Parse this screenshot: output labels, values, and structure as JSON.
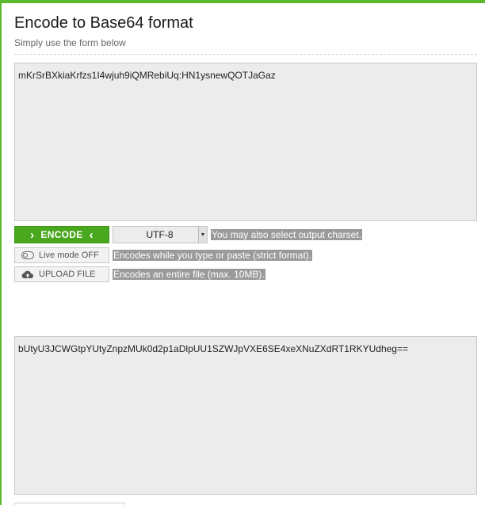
{
  "page": {
    "title": "Encode to Base64 format",
    "subtitle": "Simply use the form below"
  },
  "input": {
    "value": "mKrSrBXkiaKrfzs1I4wjuh9iQMRebiUq:HN1ysnewQOTJaGaz"
  },
  "controls": {
    "encode_label": "ENCODE",
    "charset_value": "UTF-8",
    "charset_hint": "You may also select output charset.",
    "live_mode_label": "Live mode OFF",
    "live_mode_hint": "Encodes while you type or paste (strict format).",
    "upload_label": "UPLOAD FILE",
    "upload_hint": "Encodes an entire file (max. 10MB)."
  },
  "output": {
    "value": "bUtyU3JCWGtpYUtyZnpzMUk0d2p1aDlpUU1SZWJpVXE6SE4xeXNuZXdRT1RKYUdheg=="
  },
  "colors": {
    "accent": "#4aa81e",
    "frame": "#5cb82e",
    "textarea_bg": "#ececec"
  },
  "icons": [
    "chevron-right-icon",
    "chevron-left-icon",
    "dropdown-arrow-icon",
    "toggle-icon",
    "cloud-upload-icon"
  ]
}
